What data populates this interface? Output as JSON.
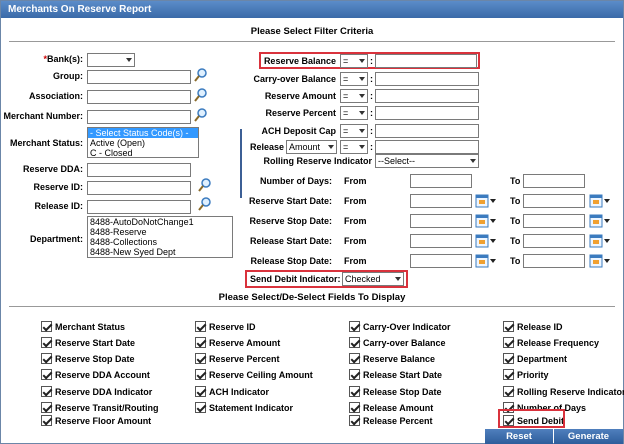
{
  "title": "Merchants On Reserve Report",
  "filter_header": "Please Select Filter Criteria",
  "fields_header": "Please Select/De-Select Fields To Display",
  "left": {
    "bank_label": "Bank(s):",
    "bank_required": "*",
    "group_label": "Group:",
    "association_label": "Association:",
    "merchant_number_label": "Merchant Number:",
    "merchant_status_label": "Merchant Status:",
    "merchant_status_options": [
      "- Select Status Code(s) -",
      "Active (Open)",
      "C - Closed"
    ],
    "reserve_dda_label": "Reserve DDA:",
    "reserve_id_label": "Reserve ID:",
    "release_id_label": "Release ID:",
    "department_label": "Department:",
    "department_options": [
      "8488-AutoDoNotChange1",
      "8488-Reserve",
      "8488-Collections",
      "8488-New Syed Dept"
    ]
  },
  "right": {
    "reserve_balance_label": "Reserve Balance",
    "reserve_balance_op": "=",
    "carryover_balance_label": "Carry-over Balance",
    "carryover_balance_op": "=",
    "reserve_amount_label": "Reserve Amount",
    "reserve_amount_op": "=",
    "reserve_percent_label": "Reserve Percent",
    "reserve_percent_op": "=",
    "ach_deposit_cap_label": "ACH Deposit Cap",
    "ach_deposit_cap_op": "=",
    "release_label": "Release",
    "release_type": "Amount",
    "release_op": "=",
    "rolling_reserve_label": "Rolling Reserve Indicator",
    "rolling_reserve_value": "--Select--",
    "colon": ":",
    "number_of_days_label": "Number of Days:",
    "reserve_start_label": "Reserve Start Date:",
    "reserve_stop_label": "Reserve Stop Date:",
    "release_start_label": "Release Start Date:",
    "release_stop_label": "Release Stop Date:",
    "from_label": "From",
    "to_label": "To",
    "send_debit_label": "Send Debit Indicator:",
    "send_debit_value": "Checked"
  },
  "checkboxes": {
    "col1": [
      "Merchant Status",
      "Reserve Start Date",
      "Reserve Stop Date",
      "Reserve DDA Account",
      "Reserve DDA Indicator",
      "Reserve Transit/Routing",
      "Reserve Floor Amount"
    ],
    "col2": [
      "Reserve ID",
      "Reserve Amount",
      "Reserve Percent",
      "Reserve Ceiling Amount",
      "ACH Indicator",
      "Statement Indicator"
    ],
    "col3": [
      "Carry-Over Indicator",
      "Carry-over Balance",
      "Reserve Balance",
      "Release Start Date",
      "Release Stop Date",
      "Release Amount",
      "Release Percent"
    ],
    "col4": [
      "Release ID",
      "Release Frequency",
      "Department",
      "Priority",
      "Rolling Reserve Indicator",
      "Number of Days",
      "Send Debit"
    ]
  },
  "buttons": {
    "reset": "Reset",
    "generate": "Generate"
  },
  "colors": {
    "title_bar": "#3a6aa8",
    "highlight_box": "#d9323c",
    "selected_option": "#3399ff"
  }
}
